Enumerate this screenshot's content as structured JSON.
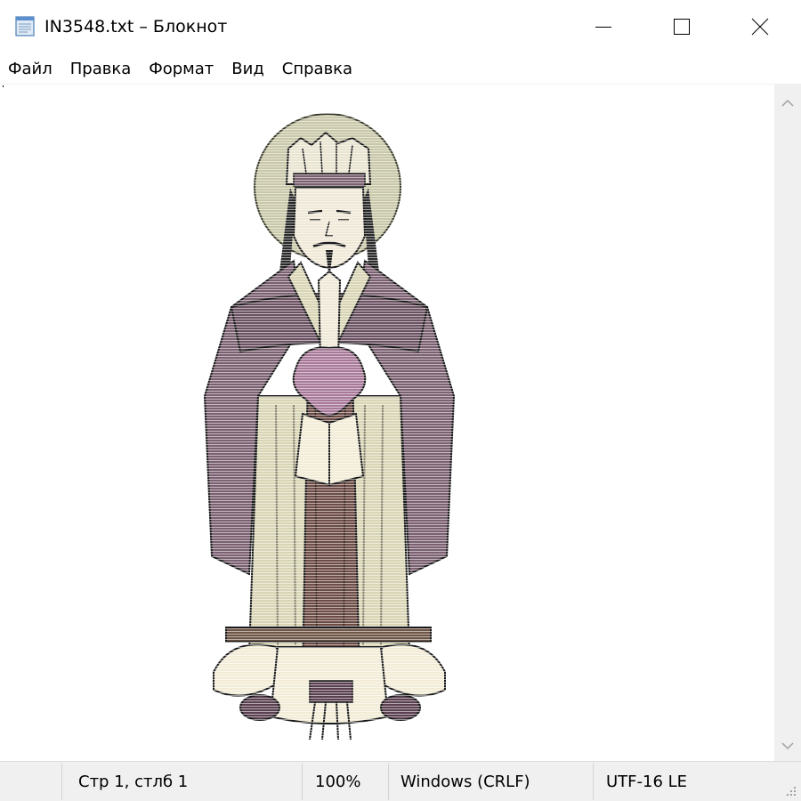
{
  "window": {
    "title": "IN3548.txt – Блокнот",
    "icon": "notepad-icon"
  },
  "controls": {
    "minimize_icon": "minimize-icon",
    "maximize_icon": "maximize-icon",
    "close_icon": "close-icon"
  },
  "menu": {
    "items": [
      {
        "label": "Файл"
      },
      {
        "label": "Правка"
      },
      {
        "label": "Формат"
      },
      {
        "label": "Вид"
      },
      {
        "label": "Справка"
      }
    ]
  },
  "editor": {
    "content_icon": "ascii-art-figure-icon"
  },
  "scrollbar": {
    "up_icon": "chevron-up-icon",
    "down_icon": "chevron-down-icon"
  },
  "status": {
    "position": "Стр 1, стлб 1",
    "zoom": "100%",
    "line_ending": "Windows (CRLF)",
    "encoding": "UTF-16 LE"
  },
  "colors": {
    "robe": "#7a6070",
    "robe_dark": "#5a4050",
    "halo": "#c8c7a8",
    "pink": "#a87898",
    "cream": "#f2ecd6",
    "under_robe": "#d8d4b4",
    "skin": "#efe8d6",
    "hem": "#6d5444",
    "chrome": "#f0f0f0"
  }
}
